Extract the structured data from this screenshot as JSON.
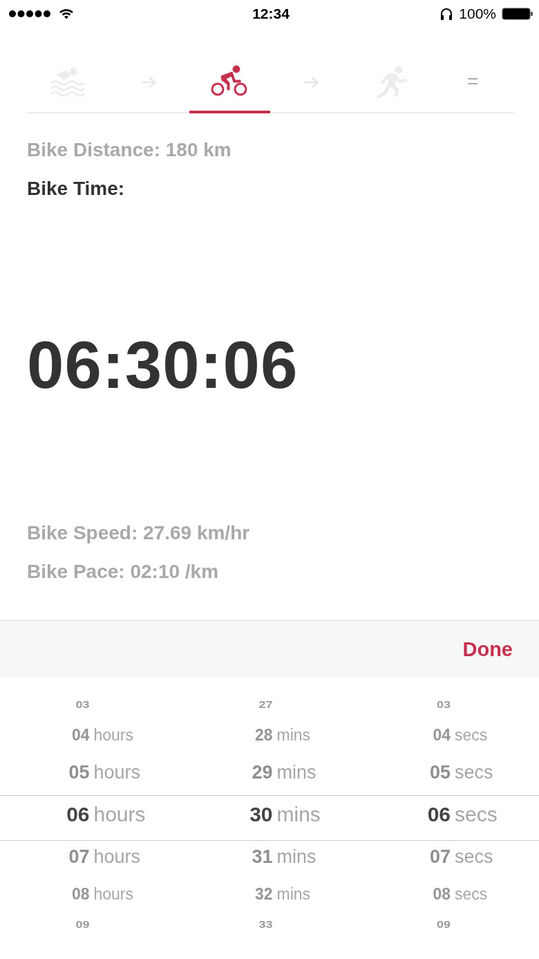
{
  "status_bar": {
    "time": "12:34",
    "battery": "100%"
  },
  "tabs": [
    {
      "kind": "swim",
      "selected": false
    },
    {
      "kind": "bike",
      "selected": true
    },
    {
      "kind": "run",
      "selected": false
    },
    {
      "kind": "total",
      "label": "=",
      "selected": false
    }
  ],
  "fields": [
    {
      "text": "Bike Distance: 180 km",
      "active": false
    },
    {
      "text": "Bike Time:",
      "active": true
    }
  ],
  "time_value": "06:30:06",
  "results": [
    {
      "text": "Bike Speed: 27.69 km/hr"
    },
    {
      "text": "Bike Pace: 02:10 /km"
    }
  ],
  "toolbar": {
    "done": "Done"
  },
  "picker": [
    {
      "rows": [
        {
          "value": "03",
          "selected": false
        },
        {
          "value": "04",
          "unit": "hours",
          "selected": false
        },
        {
          "value": "05",
          "unit": "hours",
          "selected": false
        },
        {
          "value": "06",
          "unit": "hours",
          "selected": true
        },
        {
          "value": "07",
          "unit": "hours",
          "selected": false
        },
        {
          "value": "08",
          "unit": "hours",
          "selected": false
        },
        {
          "value": "09",
          "selected": false
        }
      ]
    },
    {
      "rows": [
        {
          "value": "27",
          "selected": false
        },
        {
          "value": "28",
          "unit": "mins",
          "selected": false
        },
        {
          "value": "29",
          "unit": "mins",
          "selected": false
        },
        {
          "value": "30",
          "unit": "mins",
          "selected": true
        },
        {
          "value": "31",
          "unit": "mins",
          "selected": false
        },
        {
          "value": "32",
          "unit": "mins",
          "selected": false
        },
        {
          "value": "33",
          "selected": false
        }
      ]
    },
    {
      "rows": [
        {
          "value": "03",
          "selected": false
        },
        {
          "value": "04",
          "unit": "secs",
          "selected": false
        },
        {
          "value": "05",
          "unit": "secs",
          "selected": false
        },
        {
          "value": "06",
          "unit": "secs",
          "selected": true
        },
        {
          "value": "07",
          "unit": "secs",
          "selected": false
        },
        {
          "value": "08",
          "unit": "secs",
          "selected": false
        },
        {
          "value": "09",
          "selected": false
        }
      ]
    }
  ]
}
